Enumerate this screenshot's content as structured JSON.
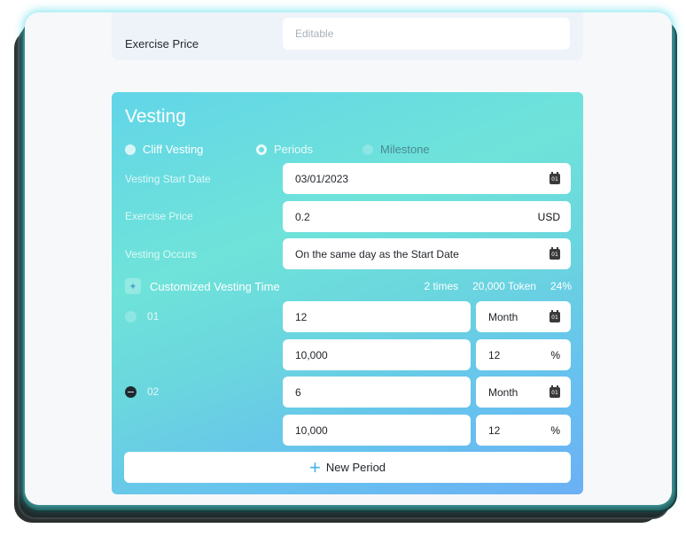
{
  "top": {
    "exercise_price_label": "Exercise Price",
    "exercise_price_placeholder": "Editable"
  },
  "vesting": {
    "title": "Vesting",
    "options": {
      "cliff": "Cliff Vesting",
      "periods": "Periods",
      "milestone": "Milestone"
    },
    "start_date_label": "Vesting Start Date",
    "start_date_value": "03/01/2023",
    "exercise_price_label": "Exercise Price",
    "exercise_price_value": "0.2",
    "currency": "USD",
    "occurs_label": "Vesting Occurs",
    "occurs_value": "On the same day as the Start Date",
    "customized": {
      "label": "Customized Vesting Time",
      "times": "2 times",
      "token": "20,000 Token",
      "percent": "24%"
    },
    "periods": [
      {
        "index": "01",
        "duration": "12",
        "unit": "Month",
        "amount": "10,000",
        "pct": "12",
        "pct_sign": "%"
      },
      {
        "index": "02",
        "duration": "6",
        "unit": "Month",
        "amount": "10,000",
        "pct": "12",
        "pct_sign": "%"
      }
    ],
    "calendar_glyph": "01",
    "new_period": "New Period"
  },
  "colors": {
    "gradient_top": "#6fe3d9",
    "gradient_bottom": "#6bb0f5",
    "accent_plus": "#45b3e2",
    "card_glow": "#5cdce8"
  }
}
